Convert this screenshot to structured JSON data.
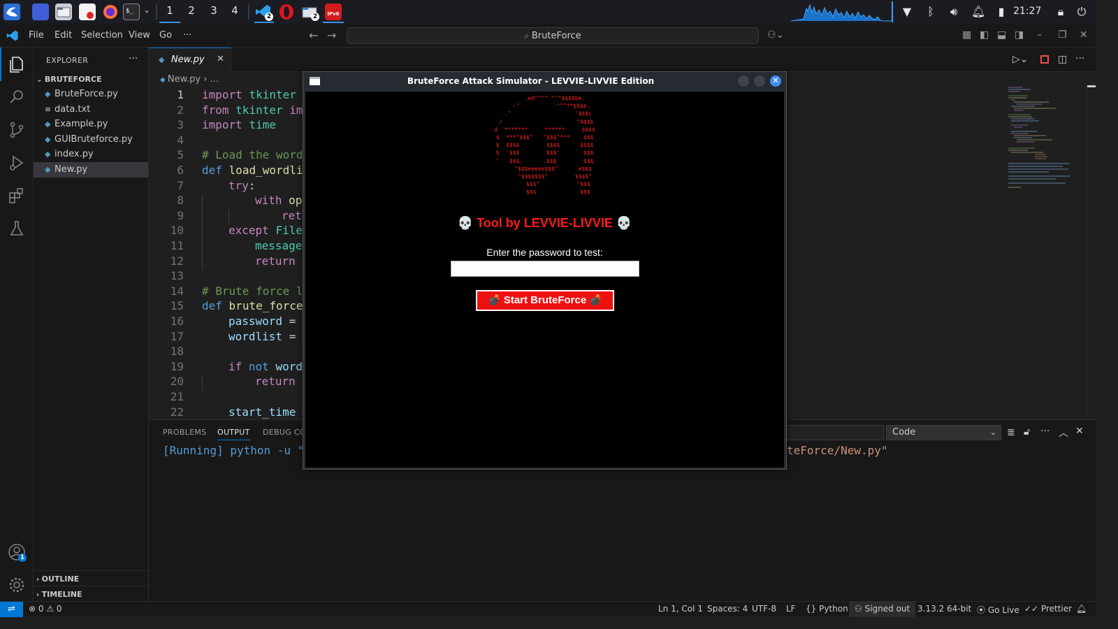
{
  "taskbar": {
    "workspaces": [
      "1",
      "2",
      "3",
      "4"
    ],
    "badge_vscode": "2",
    "badge_files": "2",
    "ipv6_label": "IPv6",
    "clock": "21:27"
  },
  "menu": {
    "file": "File",
    "edit": "Edit",
    "selection": "Selection",
    "view": "View",
    "go": "Go",
    "more": "···"
  },
  "command_center": {
    "text": "BruteForce"
  },
  "explorer": {
    "title": "EXPLORER",
    "folder": "BRUTEFORCE",
    "files": [
      {
        "name": "BruteForce.py",
        "icon": "python-file-icon"
      },
      {
        "name": "data.txt",
        "icon": "text-file-icon"
      },
      {
        "name": "Example.py",
        "icon": "python-file-icon"
      },
      {
        "name": "GUIBruteforce.py",
        "icon": "python-file-icon"
      },
      {
        "name": "index.py",
        "icon": "python-file-icon"
      },
      {
        "name": "New.py",
        "icon": "python-file-icon"
      }
    ],
    "outline": "OUTLINE",
    "timeline": "TIMELINE",
    "accounts_badge": "1"
  },
  "editor": {
    "tab_label": "New.py",
    "breadcrumb_file": "New.py",
    "breadcrumb_more": "...",
    "line_numbers": [
      "1",
      "2",
      "3",
      "4",
      "5",
      "6",
      "7",
      "8",
      "9",
      "10",
      "11",
      "12",
      "13",
      "14",
      "15",
      "16",
      "17",
      "18",
      "19",
      "20",
      "21",
      "22"
    ]
  },
  "panel": {
    "tabs": [
      "PROBLEMS",
      "OUTPUT",
      "DEBUG CO"
    ],
    "output_channel": "Code",
    "output_left": "[Running] python -u \"",
    "output_right": "teForce/New.py\""
  },
  "statusbar": {
    "errors": "0",
    "warnings": "0",
    "position": "Ln 1, Col 1",
    "spaces": "Spaces: 4",
    "encoding": "UTF-8",
    "eol": "LF",
    "language": "Python",
    "account": "Signed out",
    "interpreter": "3.13.2 64-bit",
    "go_live": "Go Live",
    "prettier": "Prettier"
  },
  "tk_window": {
    "title": "BruteForce Attack Simulator - LEVVIE-LIVVIE Edition",
    "heading": "💀 Tool by LEVVIE-LIVVIE 💀",
    "prompt": "Enter the password to test:",
    "password_value": "",
    "button_label": "💣 Start BruteForce 💣",
    "close_glyph": "✕"
  },
  "colors": {
    "accent": "#0078d4",
    "tk_text_red": "#ff1a1a",
    "tk_button": "#ee1111"
  }
}
